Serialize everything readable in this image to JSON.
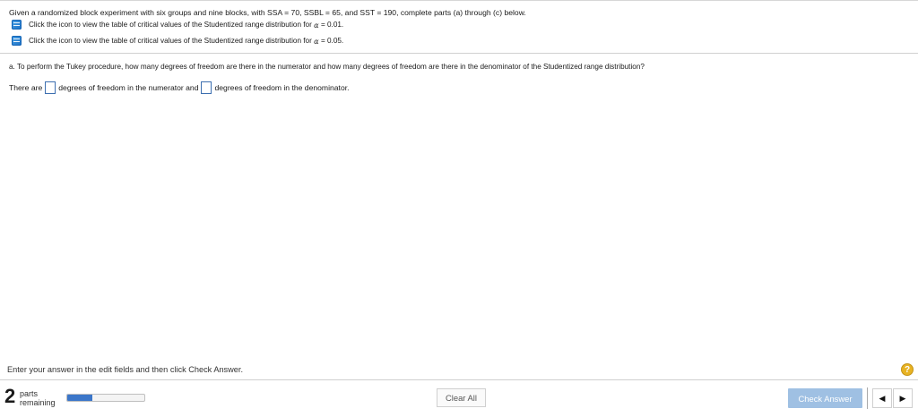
{
  "question": {
    "text": "Given a randomized block experiment with six groups and nine blocks, with SSA = 70, SSBL = 65, and SST = 190, complete parts (a) through (c) below."
  },
  "resources": [
    {
      "icon": "book-icon",
      "text": "Click the icon to view the table of critical values of the Studentized range distribution for",
      "alpha": "α",
      "value": "= 0.01."
    },
    {
      "icon": "book-icon",
      "text": "Click the icon to view the table of critical values of the Studentized range distribution for",
      "alpha": "α",
      "value": "= 0.05."
    }
  ],
  "part_a": {
    "prompt": "a. To perform the Tukey procedure, how many degrees of freedom are there in the numerator and how many degrees of freedom are there in the denominator of the Studentized range distribution?",
    "answer_prefix": "There are",
    "answer_mid": "degrees of freedom in the numerator and",
    "answer_suffix": "degrees of freedom in the denominator.",
    "numerator_value": "",
    "denominator_value": ""
  },
  "footer": {
    "instruction": "Enter your answer in the edit fields and then click Check Answer.",
    "help_symbol": "?",
    "parts_remaining_number": "2",
    "parts_label_1": "parts",
    "parts_label_2": "remaining",
    "progress_fraction": 0.33,
    "clear_all_label": "Clear All",
    "check_answer_label": "Check Answer",
    "prev_symbol": "◀",
    "next_symbol": "▶"
  }
}
